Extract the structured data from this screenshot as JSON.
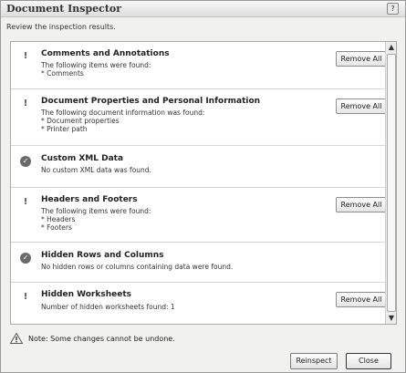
{
  "dialog": {
    "title": "Document Inspector",
    "help_label": "?",
    "subtitle": "Review the inspection results."
  },
  "items": [
    {
      "status": "issues-found",
      "status_icon": "warning-exclamation-icon",
      "heading": "Comments and Annotations",
      "details": [
        "The following items were found:",
        "* Comments"
      ],
      "button_label": "Remove All"
    },
    {
      "status": "issues-found",
      "status_icon": "warning-exclamation-icon",
      "heading": "Document Properties and Personal Information",
      "details": [
        "The following document information was found:",
        "* Document properties",
        "* Printer path"
      ],
      "button_label": "Remove All"
    },
    {
      "status": "clean",
      "status_icon": "checkmark-circle-icon",
      "heading": "Custom XML Data",
      "details": [
        "No custom XML data was found."
      ]
    },
    {
      "status": "issues-found",
      "status_icon": "warning-exclamation-icon",
      "heading": "Headers and Footers",
      "details": [
        "The following items were found:",
        "* Headers",
        "* Footers"
      ],
      "button_label": "Remove All"
    },
    {
      "status": "clean",
      "status_icon": "checkmark-circle-icon",
      "heading": "Hidden Rows and Columns",
      "details": [
        "No hidden rows or columns containing data were found."
      ]
    },
    {
      "status": "issues-found",
      "status_icon": "warning-exclamation-icon",
      "heading": "Hidden Worksheets",
      "details": [
        "Number of hidden worksheets found: 1"
      ],
      "button_label": "Remove All"
    }
  ],
  "footer": {
    "note_icon": "warning-triangle-icon",
    "note": "Note: Some changes cannot be undone.",
    "reinspect_label": "Reinspect",
    "close_label": "Close"
  },
  "colors": {
    "dialog_bg": "#f1f1ef",
    "panel_bg": "#ffffff",
    "border": "#a8a8a8"
  }
}
